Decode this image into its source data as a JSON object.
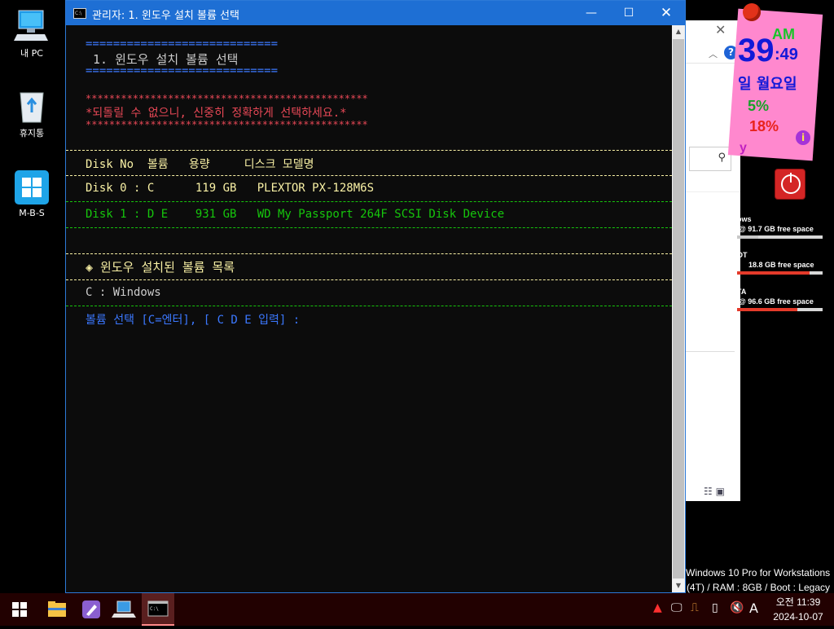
{
  "desktop": {
    "icons": [
      {
        "label": "내 PC",
        "icon": "computer-icon"
      },
      {
        "label": "휴지통",
        "icon": "recycle-bin-icon"
      },
      {
        "label": "M-B-S",
        "icon": "windows-logo-icon"
      }
    ]
  },
  "gadget": {
    "hour": "39",
    "ampm": "AM",
    "seconds": ":49",
    "day": "일 월요일",
    "cpu": "5%",
    "memory": "18%",
    "y_text": "y",
    "drives": [
      {
        "name": "ows",
        "free": "@ 91.7 GB free space",
        "used_fraction": 0.25,
        "color": "#c8c8c8"
      },
      {
        "name": "OT",
        "free": "18.8 GB free space",
        "used_fraction": 0.85,
        "color": "#e43a2a"
      },
      {
        "name": "TA",
        "free": "@ 96.6 GB free space",
        "used_fraction": 0.7,
        "color": "#e43a2a"
      }
    ]
  },
  "system_info": {
    "line1": "Windows 10 Pro for Workstations",
    "line2": "(4T) / RAM : 8GB / Boot : Legacy"
  },
  "cmd": {
    "title": "관리자:  1. 윈도우 설치 볼륨 선택",
    "header_rule": "============================",
    "header_title": " 1. 윈도우 설치 볼륨 선택",
    "warn_rule": "************************************************",
    "warning": "*되돌릴 수 없으니, 신중히 정확하게 선택하세요.*",
    "table_header": "Disk No  볼륨   용량     디스크 모델명",
    "disks": [
      "Disk 0 : C      119 GB   PLEXTOR PX-128M6S",
      "Disk 1 : D E    931 GB   WD My Passport 264F SCSI Disk Device"
    ],
    "installed_header": "◈ 윈도우 설치된 볼륨 목록",
    "installed": "C : Windows",
    "prompt": "볼륨 선택 [C=엔터], [ C D E 입력] :"
  },
  "taskbar": {
    "apps": [
      "file-explorer-icon",
      "rocket-app-icon",
      "laptop-app-icon",
      "command-prompt-icon"
    ],
    "ime": "A",
    "time": "오전 11:39",
    "date": "2024-10-07"
  },
  "colors": {
    "cmd_title_bar": "#1e6fd4",
    "console_bg": "#0c0c0c",
    "header_text": "#cccccc",
    "rule_blue": "#3b78ff",
    "warning_red": "#e74856",
    "table_yellow": "#f9f1a5",
    "disk_green": "#16c60c",
    "prompt_blue": "#3b78ff",
    "taskbar": "#220101"
  }
}
